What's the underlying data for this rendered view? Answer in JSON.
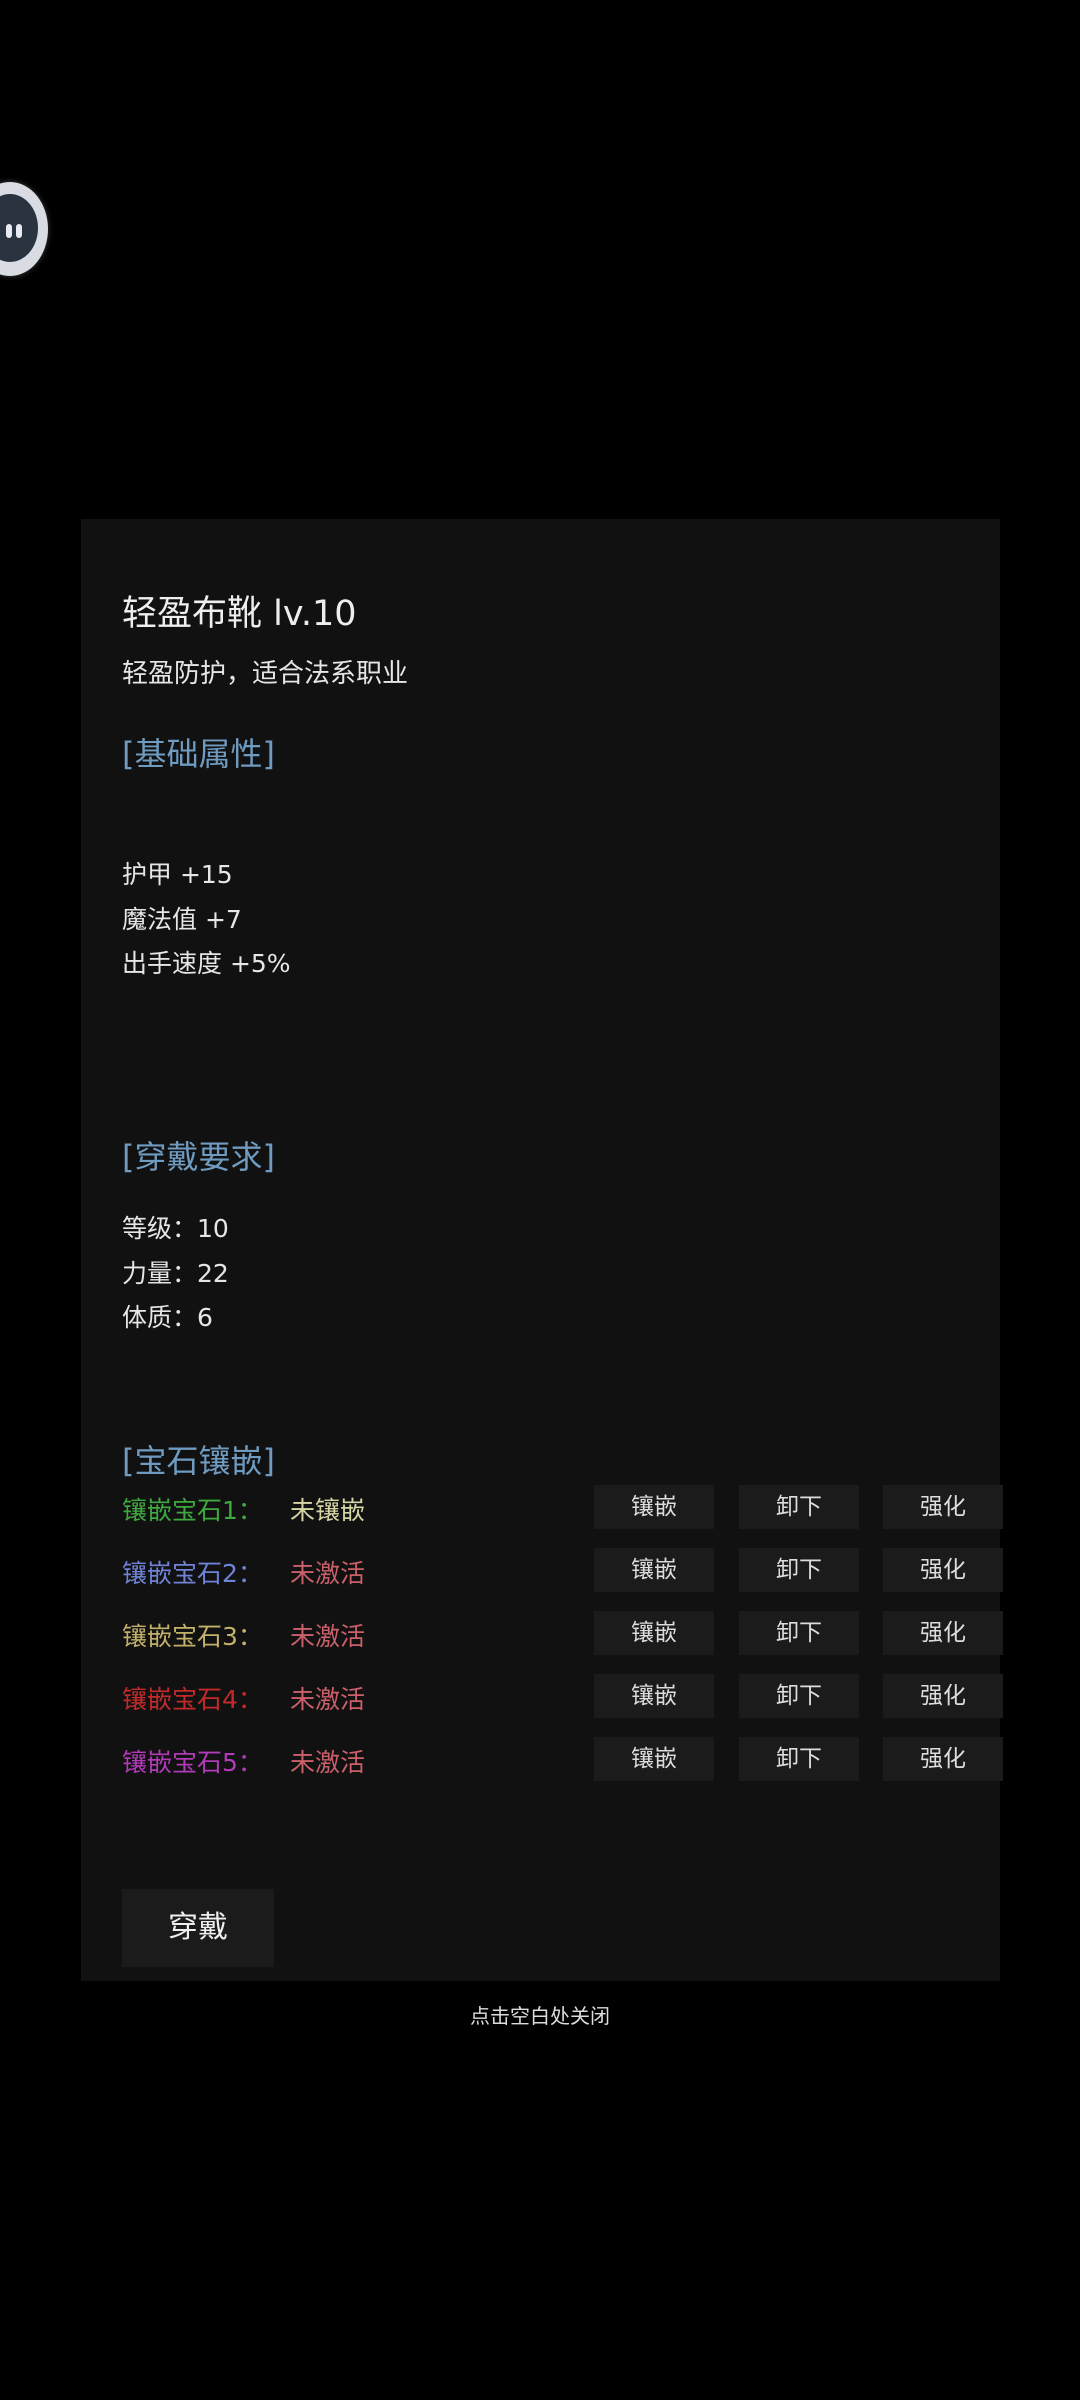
{
  "item": {
    "title": "轻盈布靴 lv.10",
    "description": "轻盈防护，适合法系职业"
  },
  "base_attributes": {
    "heading": "[基础属性]",
    "lines": [
      "护甲 +15",
      "魔法值 +7",
      "出手速度 +5%"
    ]
  },
  "requirements": {
    "heading": "[穿戴要求]",
    "lines": [
      "等级：10",
      "力量：22",
      "体质：6"
    ]
  },
  "gems": {
    "heading": "[宝石镶嵌]",
    "slots": [
      {
        "label": "镶嵌宝石1：",
        "status": "未镶嵌",
        "label_color": "#3fa83f",
        "status_color": "#d6d6a4"
      },
      {
        "label": "镶嵌宝石2：",
        "status": "未激活",
        "label_color": "#6f83d6",
        "status_color": "#c9606a"
      },
      {
        "label": "镶嵌宝石3：",
        "status": "未激活",
        "label_color": "#c3b06a",
        "status_color": "#c9606a"
      },
      {
        "label": "镶嵌宝石4：",
        "status": "未激活",
        "label_color": "#c22a2a",
        "status_color": "#c9606a"
      },
      {
        "label": "镶嵌宝石5：",
        "status": "未激活",
        "label_color": "#b03ab8",
        "status_color": "#c9606a"
      }
    ],
    "buttons": {
      "inlay": "镶嵌",
      "remove": "卸下",
      "enhance": "强化"
    }
  },
  "equip_button_label": "穿戴",
  "close_hint": "点击空白处关闭",
  "colors": {
    "background": "#000000",
    "panel": "#111111",
    "section_heading": "#6f9bc0",
    "button_bg": "#1b1b1b"
  },
  "icons": {
    "floating_ball": "assistant-ball-icon"
  }
}
